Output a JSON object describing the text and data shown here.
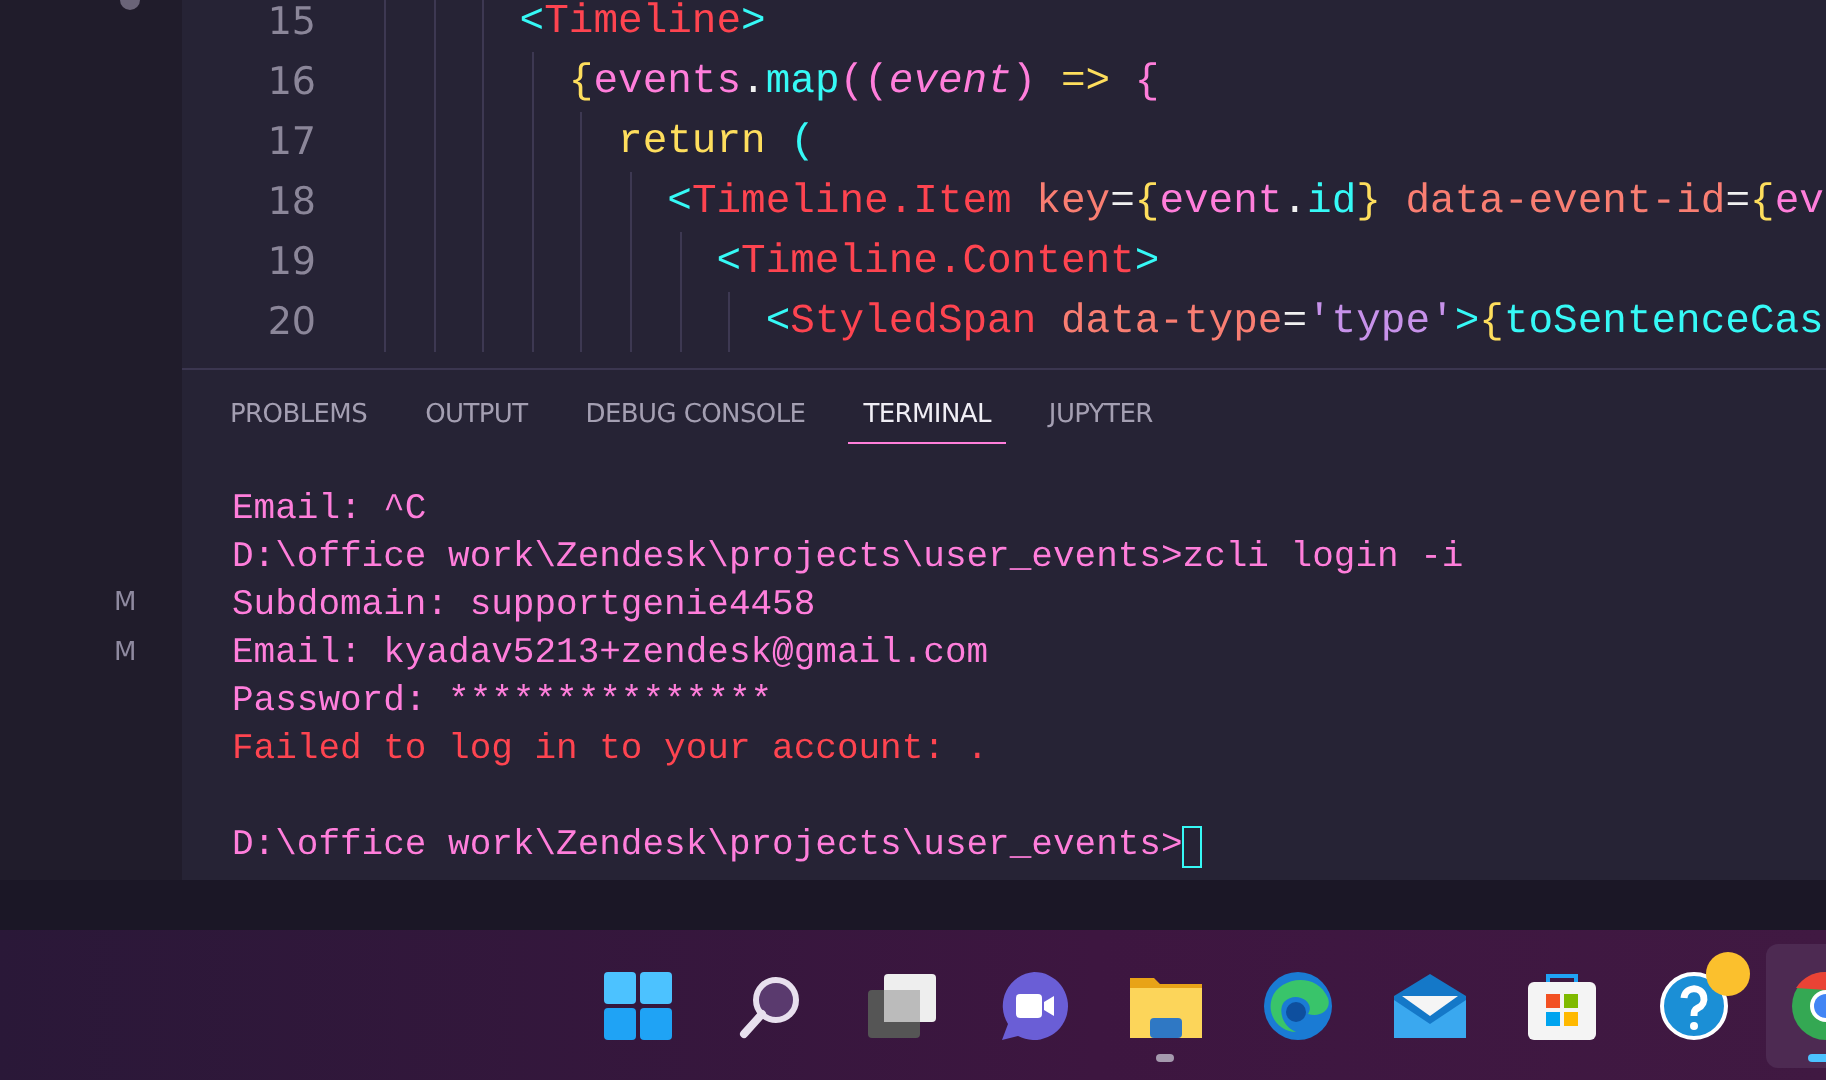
{
  "sidebar": {
    "markers": [
      "M",
      "M"
    ]
  },
  "editor": {
    "lines": [
      {
        "number": "15",
        "tokens": [
          {
            "text": "      <",
            "color": "#36f9f6"
          },
          {
            "text": "Timeline",
            "color": "#fe4450"
          },
          {
            "text": ">",
            "color": "#36f9f6"
          }
        ]
      },
      {
        "number": "16",
        "tokens": [
          {
            "text": "        {",
            "color": "#fede5d"
          },
          {
            "text": "events",
            "color": "#ff7edb"
          },
          {
            "text": ".",
            "color": "#f0f0f0"
          },
          {
            "text": "map",
            "color": "#36f9f6"
          },
          {
            "text": "((",
            "color": "#ff7edb"
          },
          {
            "text": "event",
            "color": "#ff7edb",
            "italic": true
          },
          {
            "text": ") ",
            "color": "#ff7edb"
          },
          {
            "text": "=> ",
            "color": "#fede5d"
          },
          {
            "text": "{",
            "color": "#ff7edb"
          }
        ]
      },
      {
        "number": "17",
        "tokens": [
          {
            "text": "          return ",
            "color": "#fede5d"
          },
          {
            "text": "(",
            "color": "#36f9f6"
          }
        ]
      },
      {
        "number": "18",
        "tokens": [
          {
            "text": "            <",
            "color": "#36f9f6"
          },
          {
            "text": "Timeline.Item ",
            "color": "#fe4450"
          },
          {
            "text": "key",
            "color": "#f97e72"
          },
          {
            "text": "=",
            "color": "#f0f0f0"
          },
          {
            "text": "{",
            "color": "#fede5d"
          },
          {
            "text": "event",
            "color": "#ff7edb"
          },
          {
            "text": ".",
            "color": "#f0f0f0"
          },
          {
            "text": "id",
            "color": "#36f9f6"
          },
          {
            "text": "} ",
            "color": "#fede5d"
          },
          {
            "text": "data-event-id",
            "color": "#f97e72"
          },
          {
            "text": "=",
            "color": "#f0f0f0"
          },
          {
            "text": "{",
            "color": "#fede5d"
          },
          {
            "text": "ev",
            "color": "#ff7edb"
          }
        ]
      },
      {
        "number": "19",
        "tokens": [
          {
            "text": "              <",
            "color": "#36f9f6"
          },
          {
            "text": "Timeline.Content",
            "color": "#fe4450"
          },
          {
            "text": ">",
            "color": "#36f9f6"
          }
        ]
      },
      {
        "number": "20",
        "tokens": [
          {
            "text": "                <",
            "color": "#36f9f6"
          },
          {
            "text": "StyledSpan ",
            "color": "#fe4450"
          },
          {
            "text": "data-type",
            "color": "#f97e72"
          },
          {
            "text": "=",
            "color": "#f0f0f0"
          },
          {
            "text": "'type'",
            "color": "#c792ea"
          },
          {
            "text": ">",
            "color": "#36f9f6"
          },
          {
            "text": "{",
            "color": "#fede5d"
          },
          {
            "text": "toSentenceCas",
            "color": "#36f9f6"
          }
        ]
      }
    ]
  },
  "panel": {
    "tabs": [
      {
        "label": "PROBLEMS",
        "selected": false
      },
      {
        "label": "OUTPUT",
        "selected": false
      },
      {
        "label": "DEBUG CONSOLE",
        "selected": false
      },
      {
        "label": "TERMINAL",
        "selected": true
      },
      {
        "label": "JUPYTER",
        "selected": false
      }
    ],
    "terminal": [
      {
        "text": "Email: ^C",
        "kind": "output"
      },
      {
        "text": "D:\\office work\\Zendesk\\projects\\user_events>zcli login -i",
        "kind": "output"
      },
      {
        "text": "Subdomain: supportgenie4458",
        "kind": "output"
      },
      {
        "text": "Email: kyadav5213+zendesk@gmail.com",
        "kind": "output"
      },
      {
        "text": "Password: ***************",
        "kind": "output"
      },
      {
        "text": "Failed to log in to your account: .",
        "kind": "error"
      },
      {
        "kind": "blank"
      },
      {
        "text": "D:\\office work\\Zendesk\\projects\\user_events>",
        "kind": "prompt"
      }
    ]
  },
  "taskbar": {
    "items": [
      {
        "kind": "start",
        "running": false,
        "active": false,
        "badge": false
      },
      {
        "kind": "search",
        "running": false,
        "active": false,
        "badge": false
      },
      {
        "kind": "taskview",
        "running": false,
        "active": false,
        "badge": false
      },
      {
        "kind": "chat",
        "running": false,
        "active": false,
        "badge": false
      },
      {
        "kind": "folder",
        "running": true,
        "active": false,
        "badge": false
      },
      {
        "kind": "edge",
        "running": false,
        "active": false,
        "badge": false
      },
      {
        "kind": "mail",
        "running": false,
        "active": false,
        "badge": false
      },
      {
        "kind": "store",
        "running": false,
        "active": false,
        "badge": false
      },
      {
        "kind": "help",
        "running": false,
        "active": false,
        "badge": true
      },
      {
        "kind": "chrome",
        "running": true,
        "active": true,
        "badge": false
      }
    ]
  }
}
